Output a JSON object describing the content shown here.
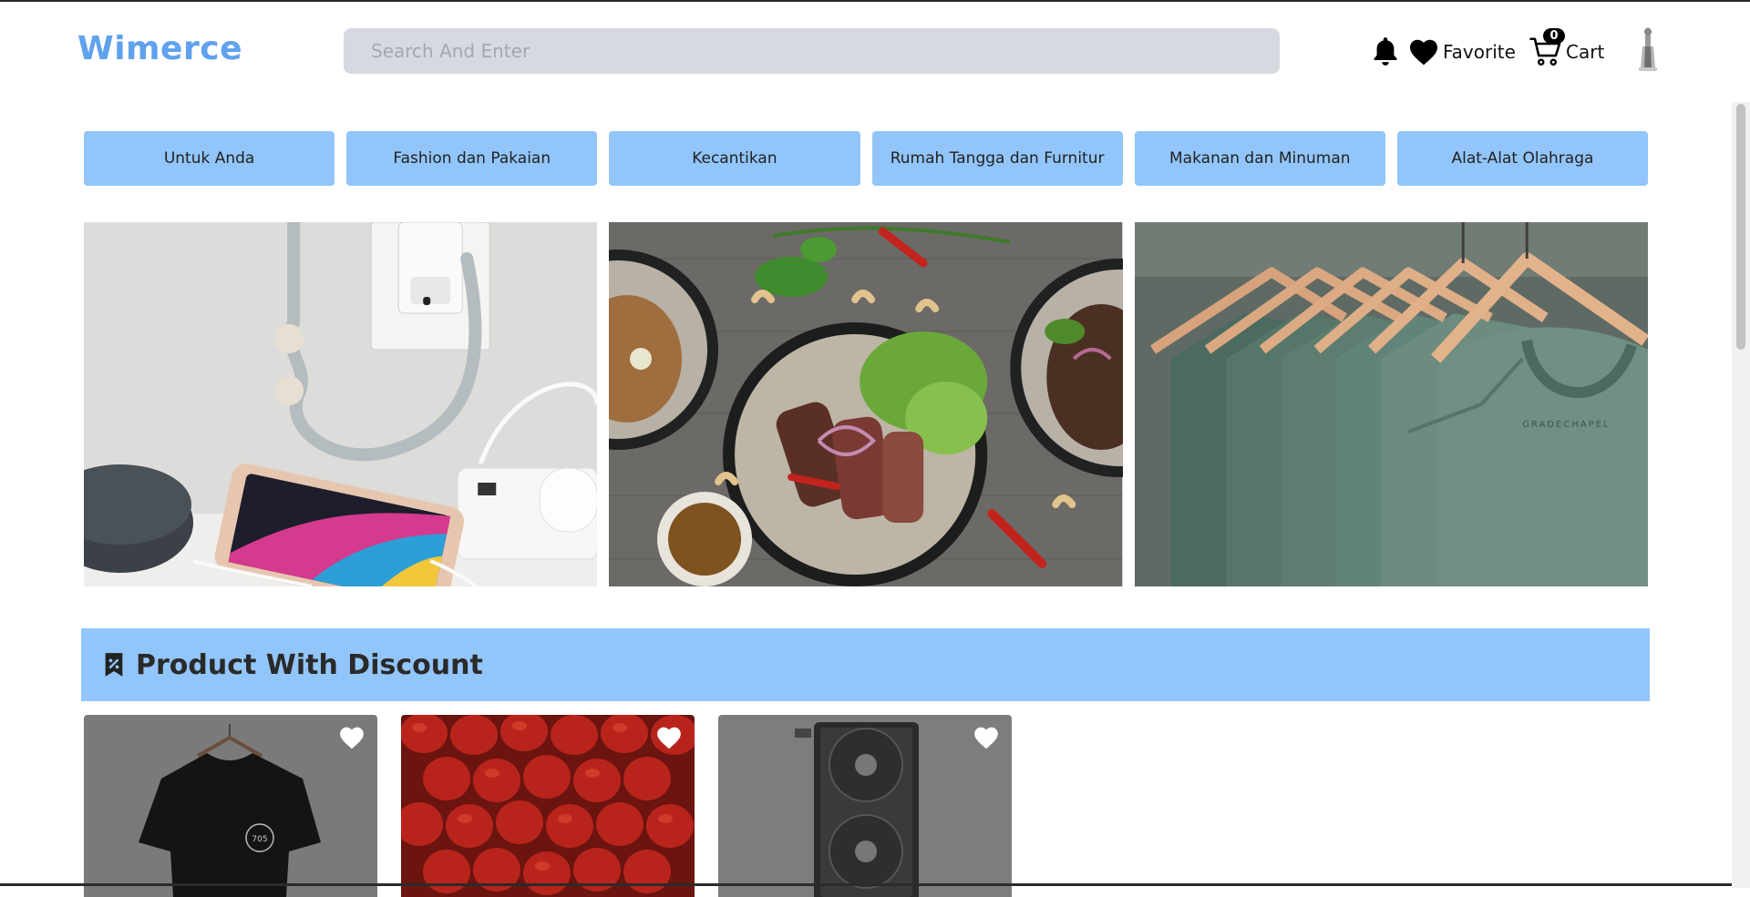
{
  "header": {
    "logo": "Wimerce",
    "search_placeholder": "Search And Enter",
    "favorite_label": "Favorite",
    "cart_label": "Cart",
    "cart_count": "0"
  },
  "categories": [
    {
      "label": "Untuk Anda"
    },
    {
      "label": "Fashion dan Pakaian"
    },
    {
      "label": "Kecantikan"
    },
    {
      "label": "Rumah Tangga dan Furnitur"
    },
    {
      "label": "Makanan dan Minuman"
    },
    {
      "label": "Alat-Alat Olahraga"
    }
  ],
  "banners": [
    {
      "subject": "phone charging on table"
    },
    {
      "subject": "plates of grilled meat and salad"
    },
    {
      "subject": "green t-shirts on hangers"
    }
  ],
  "tshirt_print": "GRADECHAPEL",
  "section": {
    "title": "Product With Discount",
    "icon": "discount-tag-icon"
  },
  "products": [
    {
      "subject": "black t-shirt on hanger",
      "shirt_print": "705"
    },
    {
      "subject": "strawberries"
    },
    {
      "subject": "graphics card"
    }
  ],
  "colors": {
    "brand": "#5fa2ee",
    "category_bg": "#92c5fa",
    "search_bg": "#d6d9df"
  }
}
